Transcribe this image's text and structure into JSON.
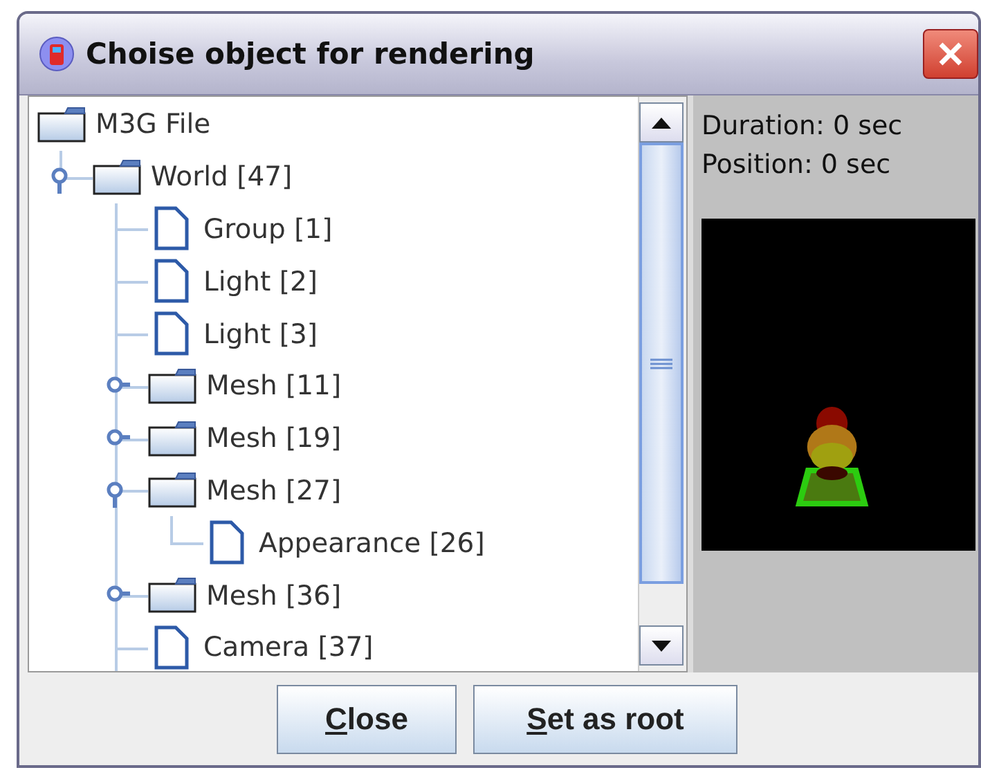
{
  "window": {
    "title": "Choise object for rendering"
  },
  "tree": {
    "label": "M3G File",
    "kind": "folder",
    "children": [
      {
        "label": "World [47]",
        "kind": "folder",
        "expanded": true,
        "children": [
          {
            "label": "Group [1]",
            "kind": "file"
          },
          {
            "label": "Light [2]",
            "kind": "file"
          },
          {
            "label": "Light [3]",
            "kind": "file"
          },
          {
            "label": "Mesh [11]",
            "kind": "folder",
            "expanded": false
          },
          {
            "label": "Mesh [19]",
            "kind": "folder",
            "expanded": false
          },
          {
            "label": "Mesh [27]",
            "kind": "folder",
            "expanded": true,
            "children": [
              {
                "label": "Appearance [26]",
                "kind": "file"
              }
            ]
          },
          {
            "label": "Mesh [36]",
            "kind": "folder",
            "expanded": false
          },
          {
            "label": "Camera [37]",
            "kind": "file"
          }
        ]
      }
    ]
  },
  "playback": {
    "duration": "Duration: 0 sec",
    "position": "Position: 0 sec"
  },
  "buttons": [
    {
      "label": "Close",
      "first_letter_underlined": true
    },
    {
      "label": "Set as root",
      "first_letter_underlined": true
    }
  ]
}
